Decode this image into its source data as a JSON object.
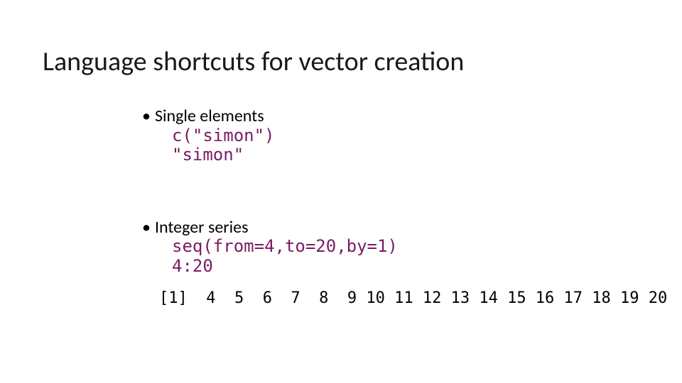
{
  "title": "Language shortcuts for vector creation",
  "sections": {
    "single": {
      "heading": "Single elements",
      "code1": "c(\"simon\")",
      "code2": "\"simon\""
    },
    "integer": {
      "heading": "Integer series",
      "code1": "seq(from=4,to=20,by=1)",
      "code2": "4:20",
      "output": "[1]  4  5  6  7  8  9 10 11 12 13 14 15 16 17 18 19 20"
    }
  }
}
